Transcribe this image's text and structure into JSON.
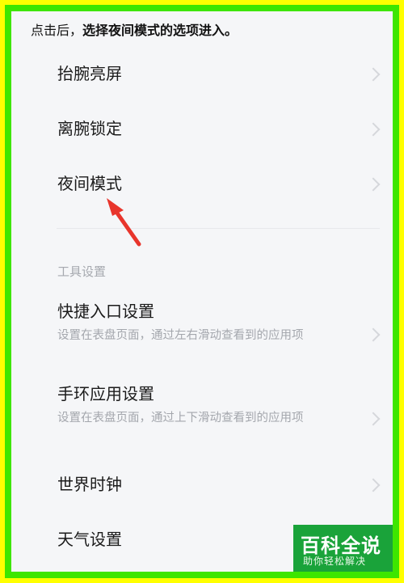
{
  "caption": {
    "prefix": "点击后，",
    "emphasis": "选择夜间模式的选项进入。"
  },
  "settings": {
    "items": [
      {
        "title": "抬腕亮屏"
      },
      {
        "title": "离腕锁定"
      },
      {
        "title": "夜间模式"
      }
    ]
  },
  "tools": {
    "header": "工具设置",
    "items": [
      {
        "title": "快捷入口设置",
        "subtitle": "设置在表盘页面，通过左右滑动查看到的应用项"
      },
      {
        "title": "手环应用设置",
        "subtitle": "设置在表盘页面，通过上下滑动查看到的应用项"
      },
      {
        "title": "世界时钟"
      },
      {
        "title": "天气设置"
      }
    ]
  },
  "watermark": {
    "title": "百科全说",
    "subtitle": "助你轻松解决"
  },
  "colors": {
    "outer_border": "#ffff00",
    "inner_border": "#3ee600",
    "background": "#f5f6f8",
    "arrow": "#e8352c",
    "watermark_bg": "#1aa33a"
  }
}
